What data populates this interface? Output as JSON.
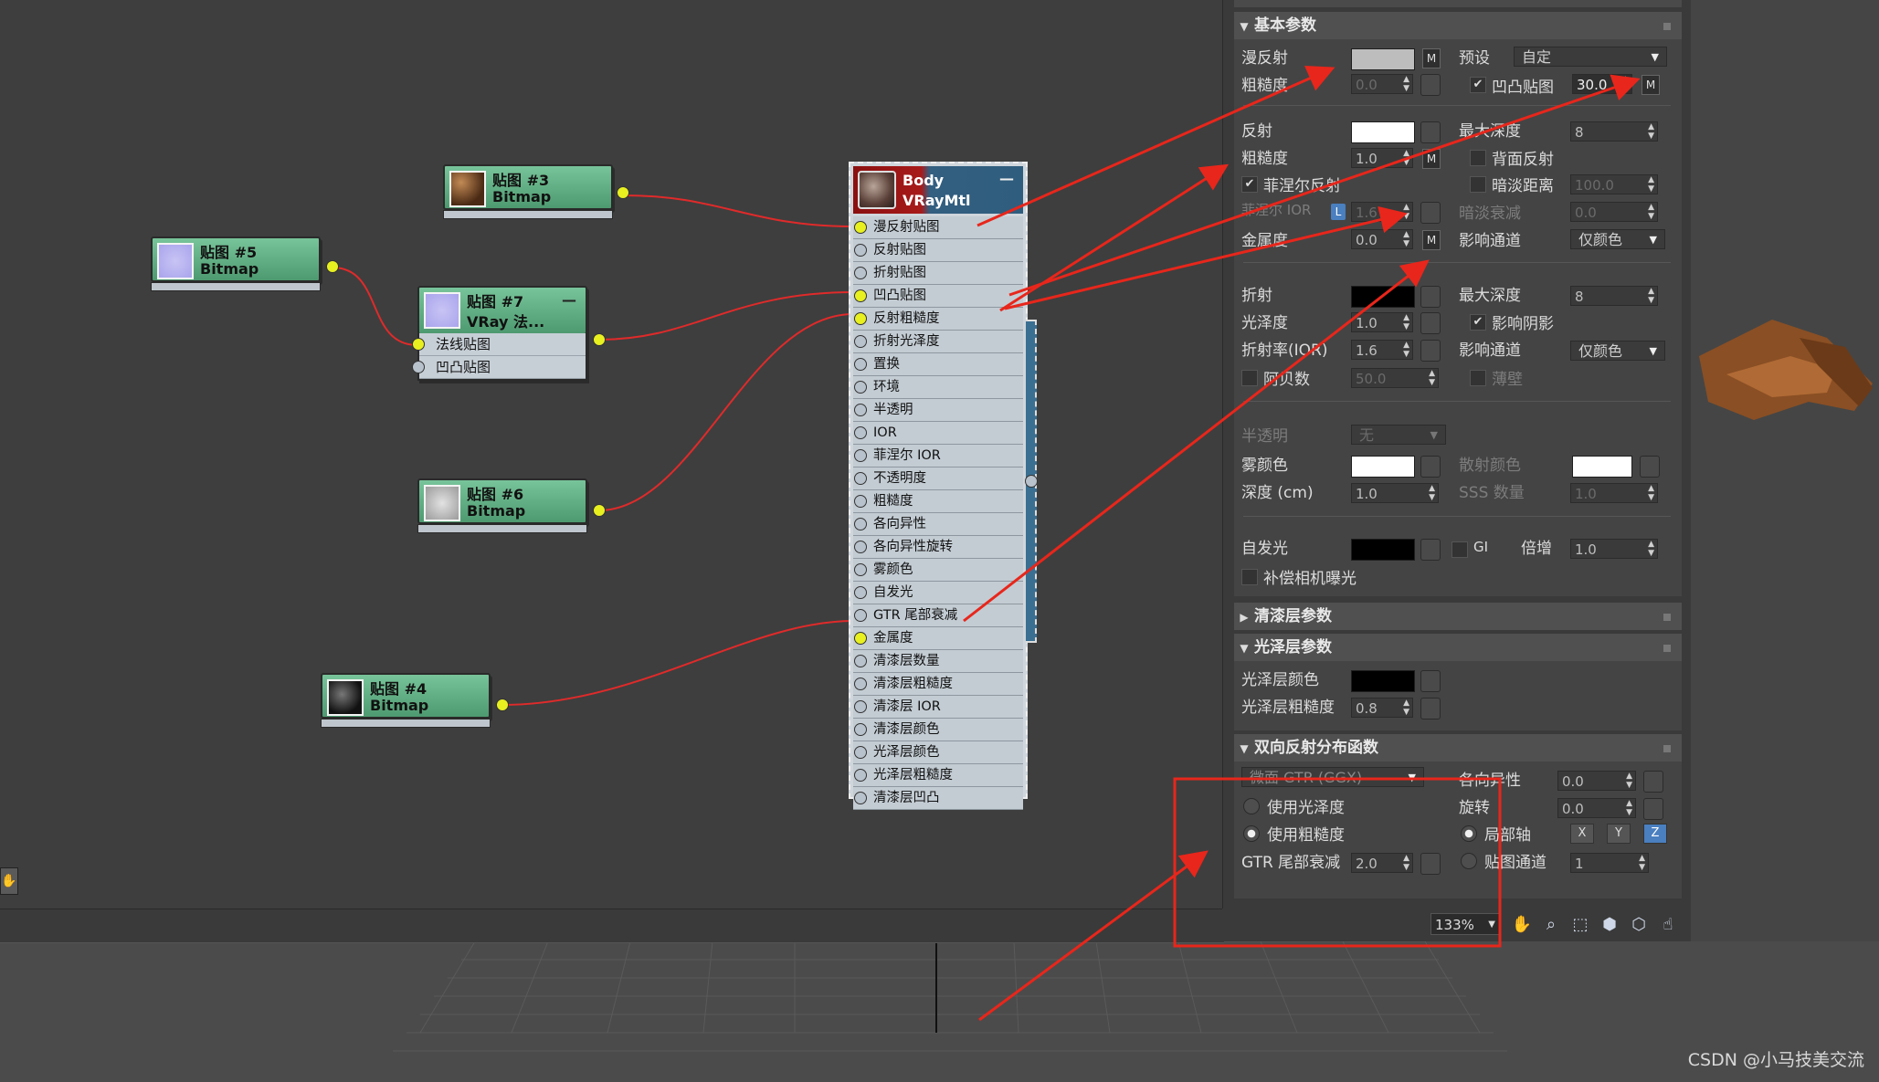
{
  "nodes": {
    "map3": {
      "title": "贴图 #3",
      "type": "Bitmap"
    },
    "map5": {
      "title": "贴图 #5",
      "type": "Bitmap"
    },
    "map7": {
      "title": "贴图 #7",
      "type": "VRay 法...",
      "slots": [
        "法线贴图",
        "凹凸贴图"
      ],
      "collapse": "—"
    },
    "map6": {
      "title": "贴图 #6",
      "type": "Bitmap"
    },
    "map4": {
      "title": "贴图 #4",
      "type": "Bitmap"
    },
    "body": {
      "title": "Body",
      "type": "VRayMtl",
      "collapse": "—",
      "slots": [
        "漫反射贴图",
        "反射贴图",
        "折射贴图",
        "凹凸贴图",
        "反射粗糙度",
        "折射光泽度",
        "置换",
        "环境",
        "半透明",
        "IOR",
        "菲涅尔 IOR",
        "不透明度",
        "粗糙度",
        "各向异性",
        "各向异性旋转",
        "雾颜色",
        "自发光",
        "GTR 尾部衰减",
        "金属度",
        "清漆层数量",
        "清漆层粗糙度",
        "清漆层 IOR",
        "清漆层颜色",
        "光泽层颜色",
        "光泽层粗糙度",
        "清漆层凹凸"
      ]
    }
  },
  "panel": {
    "basic": {
      "header": "基本参数",
      "diffuse": "漫反射",
      "roughness": "粗糙度",
      "roughness_val": "0.0",
      "preset": "预设",
      "preset_val": "自定",
      "bump_map": "凹凸贴图",
      "bump_val": "30.0",
      "m": "M",
      "reflect": "反射",
      "refl_gloss": "粗糙度",
      "refl_gloss_val": "1.0",
      "max_depth": "最大深度",
      "max_depth_val": "8",
      "back_reflect": "背面反射",
      "fresnel": "菲涅尔反射",
      "dim_dist": "暗淡距离",
      "dim_dist_val": "100.0",
      "fresnel_ior": "菲涅尔 IOR",
      "fresnel_ior_val": "1.6",
      "L": "L",
      "dim_falloff": "暗淡衰减",
      "dim_falloff_val": "0.0",
      "metalness": "金属度",
      "metalness_val": "0.0",
      "affect_ch": "影响通道",
      "affect_ch_val": "仅颜色",
      "refract": "折射",
      "refr_max_depth": "最大深度",
      "refr_max_depth_val": "8",
      "glossiness": "光泽度",
      "glossiness_val": "1.0",
      "affect_shadow": "影响阴影",
      "ior": "折射率(IOR)",
      "ior_val": "1.6",
      "refr_affect_ch": "影响通道",
      "refr_affect_ch_val": "仅颜色",
      "abbe": "阿贝数",
      "abbe_val": "50.0",
      "thin_wall": "薄壁",
      "translucency": "半透明",
      "translucency_val": "无",
      "fog_color": "雾颜色",
      "scatter_color": "散射颜色",
      "depth": "深度 (cm)",
      "depth_val": "1.0",
      "sss_amount": "SSS 数量",
      "sss_amount_val": "1.0",
      "self_illum": "自发光",
      "gi": "GI",
      "multiplier": "倍增",
      "multiplier_val": "1.0",
      "comp_exposure": "补偿相机曝光"
    },
    "coat": {
      "header": "清漆层参数"
    },
    "sheen": {
      "header": "光泽层参数",
      "color": "光泽层颜色",
      "gloss": "光泽层粗糙度",
      "gloss_val": "0.8"
    },
    "brdf": {
      "header": "双向反射分布函数",
      "type_val": "微面 GTR (GGX)",
      "aniso": "各向异性",
      "aniso_val": "0.0",
      "use_gloss": "使用光泽度",
      "rotation": "旋转",
      "rotation_val": "0.0",
      "use_rough": "使用粗糙度",
      "local_axis": "局部轴",
      "x": "X",
      "y": "Y",
      "z": "Z",
      "gtr_tail": "GTR 尾部衰减",
      "gtr_tail_val": "2.0",
      "map_channel": "贴图通道",
      "map_channel_val": "1"
    },
    "toolbar": {
      "zoom": "133%"
    }
  },
  "watermark": "CSDN @小马技美交流",
  "colors": {
    "annotation": "#e8261b",
    "node_green": "#5fae82",
    "port_yellow": "#e8f020",
    "body_red": "#9a1414",
    "body_blue": "#2f5d7e"
  }
}
